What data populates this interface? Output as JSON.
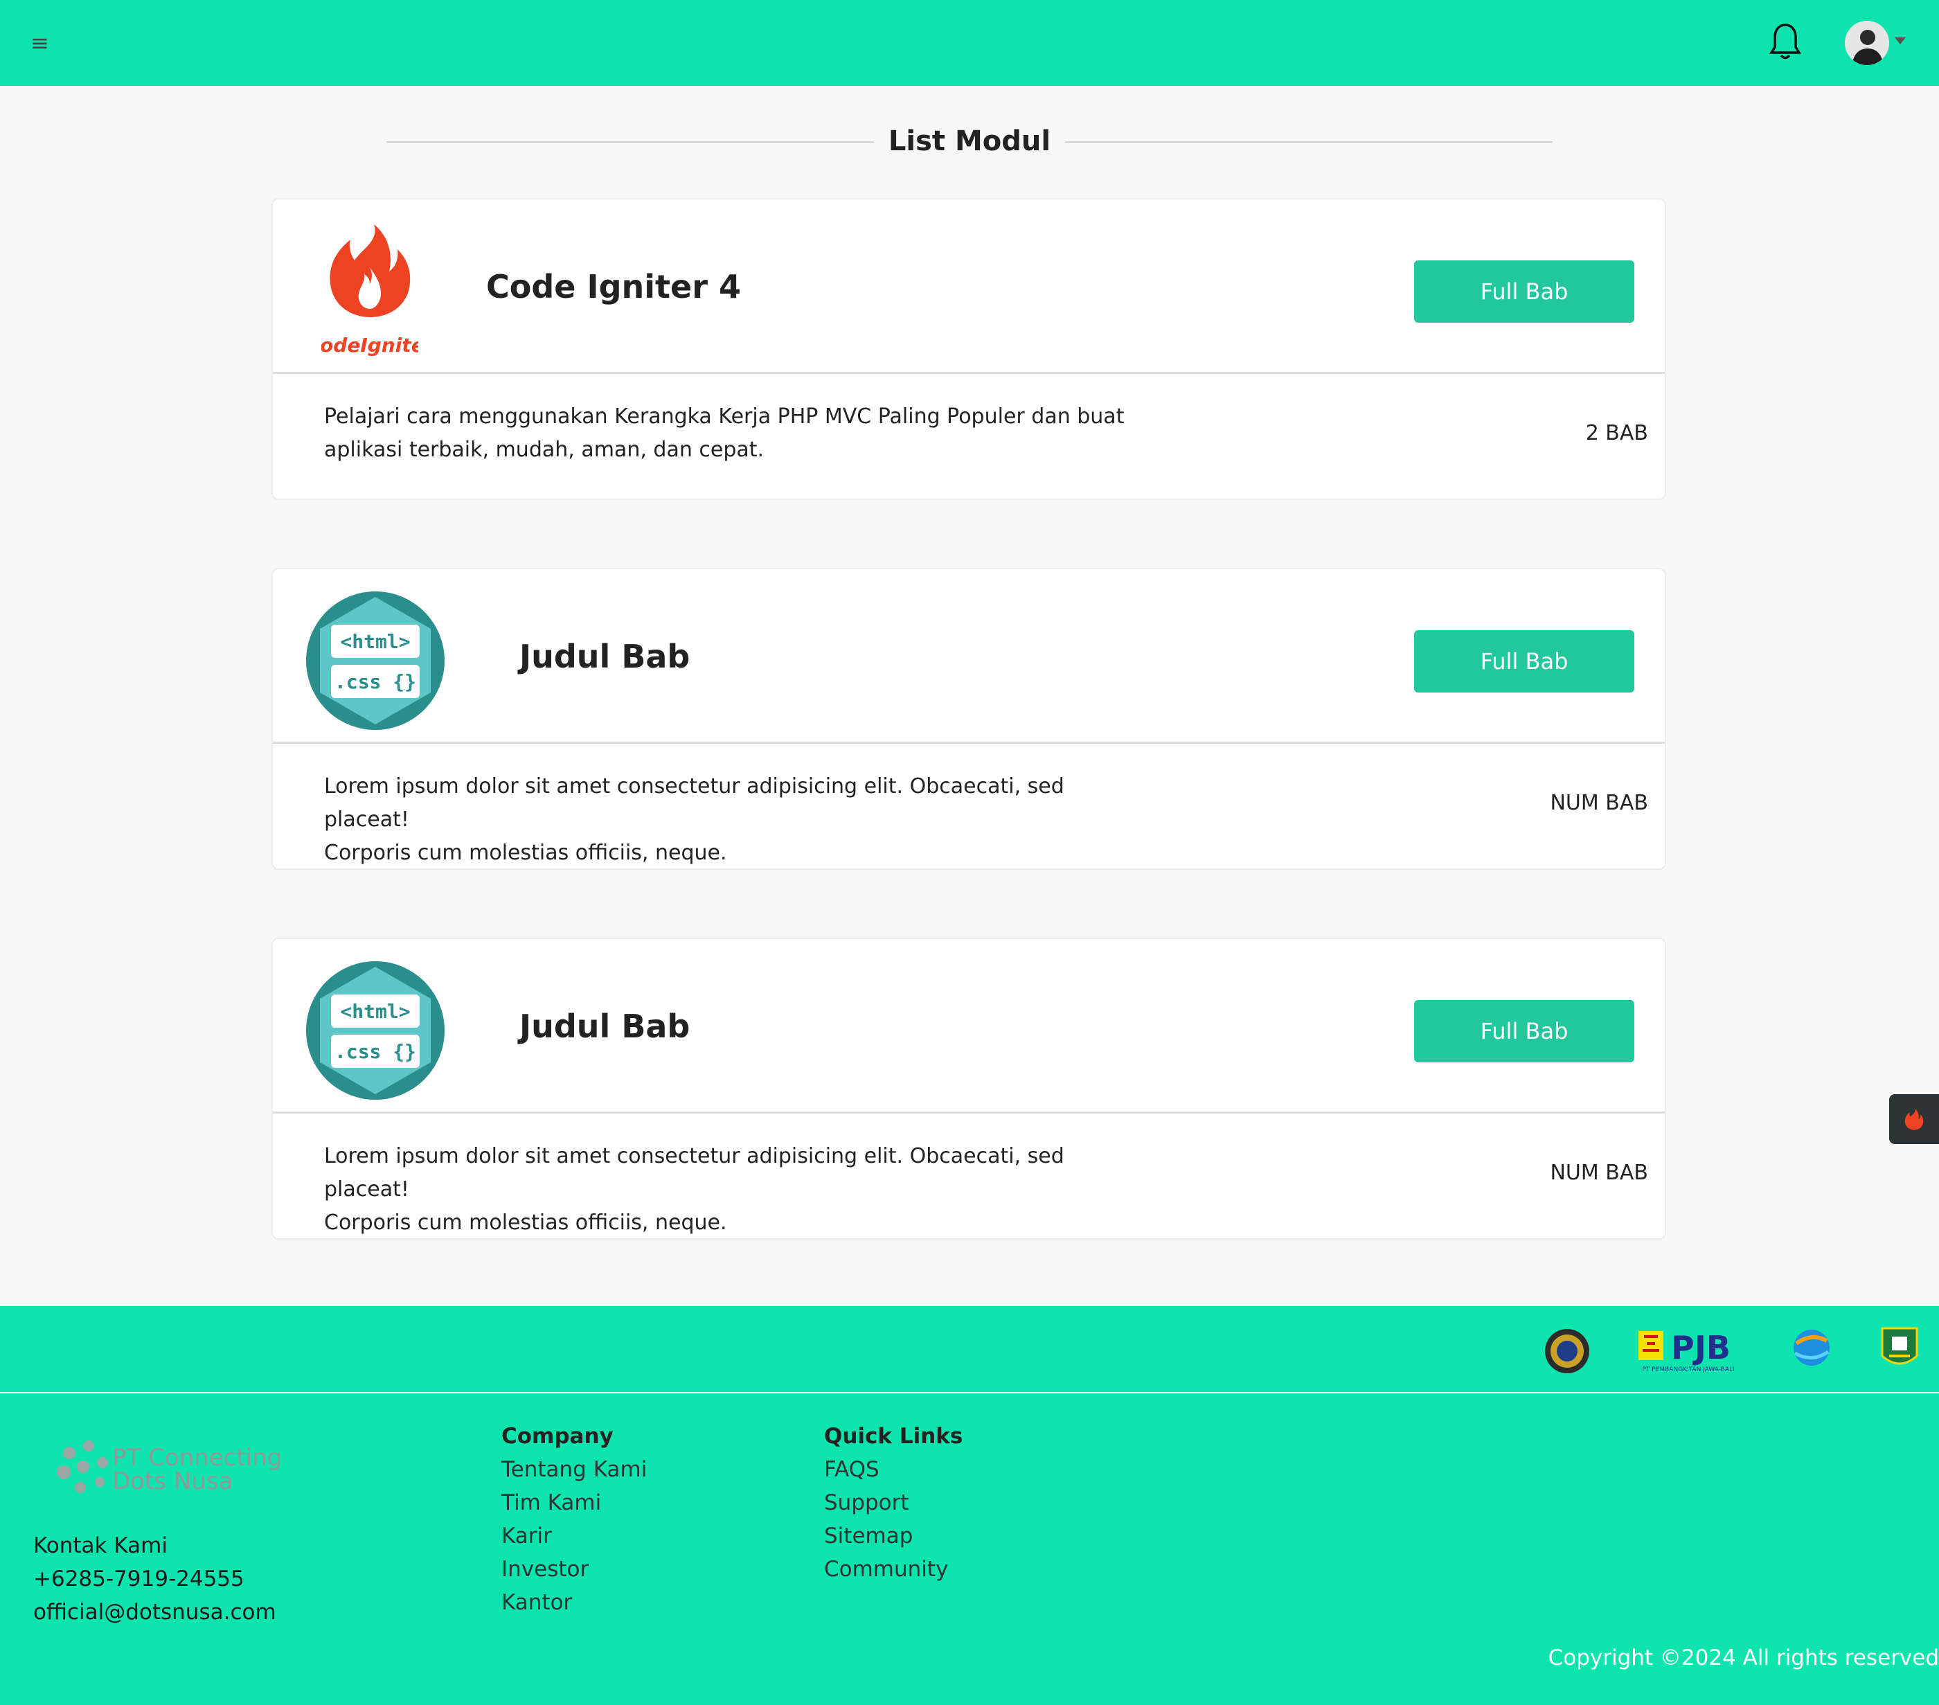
{
  "header": {
    "menu_icon": "hamburger-icon",
    "bell_icon": "bell-icon",
    "avatar_icon": "user-avatar"
  },
  "page": {
    "title": "List Modul"
  },
  "modules": [
    {
      "title": "Code Igniter 4",
      "logo": "codeigniter-logo",
      "logo_text": "CodeIgniter",
      "button": "Full Bab",
      "description_line1": "Pelajari cara menggunakan Kerangka Kerja PHP MVC Paling Populer dan buat",
      "description_line2": "aplikasi terbaik, mudah, aman, dan cepat.",
      "count": "2 BAB"
    },
    {
      "title": "Judul Bab",
      "logo": "html-css-logo",
      "logo_line1": "<html>",
      "logo_line2": ".css {}",
      "button": "Full Bab",
      "description_line1": "Lorem ipsum dolor sit amet consectetur adipisicing elit. Obcaecati, sed placeat!",
      "description_line2": "Corporis cum molestias officiis, neque.",
      "count": "NUM BAB"
    },
    {
      "title": "Judul Bab",
      "logo": "html-css-logo",
      "logo_line1": "<html>",
      "logo_line2": ".css {}",
      "button": "Full Bab",
      "description_line1": "Lorem ipsum dolor sit amet consectetur adipisicing elit. Obcaecati, sed placeat!",
      "description_line2": "Corporis cum molestias officiis, neque.",
      "count": "NUM BAB"
    }
  ],
  "footer": {
    "partners": [
      "university-seal-logo",
      "pjb-logo",
      "globe-logo",
      "regional-emblem-logo"
    ],
    "pjb_text": "PJB",
    "pjb_subtext": "PT PEMBANGKITAN JAWA-BALI",
    "company_logo_line1": "PT Connecting",
    "company_logo_line2": "Dots Nusa",
    "contact_title": "Kontak Kami",
    "phone": "+6285-7919-24555",
    "email": "official@dotsnusa.com",
    "company": {
      "heading": "Company",
      "links": [
        "Tentang Kami",
        "Tim Kami",
        "Karir",
        "Investor",
        "Kantor"
      ]
    },
    "quick_links": {
      "heading": "Quick Links",
      "links": [
        "FAQS",
        "Support",
        "Sitemap",
        "Community"
      ]
    },
    "copyright": "Copyright ©2024 All rights reserved"
  },
  "colors": {
    "brand": "#0ee4ae",
    "button": "#22c79d",
    "codeigniter": "#ee4323",
    "html_logo": "#5ec6c8"
  }
}
